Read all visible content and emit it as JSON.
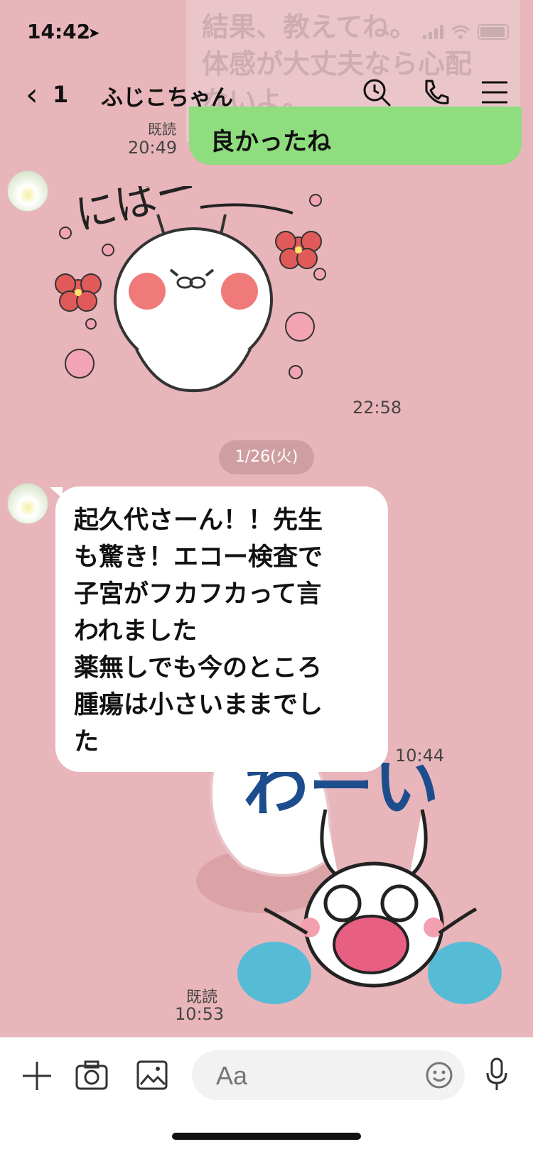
{
  "status_bar": {
    "time": "14:42"
  },
  "header": {
    "back_count": "1",
    "title": "ふじこちゃん"
  },
  "previous_message": {
    "faded_text": "結果、教えてね。\n体感が大丈夫なら心配\nないよ。",
    "visible_text": "良かったね",
    "read_label": "既読",
    "time": "20:49"
  },
  "sticker_1": {
    "text": "にぱー",
    "time": "22:58"
  },
  "date_separator": "1/26(火)",
  "incoming_message": {
    "text": "起久代さーん！！先生\nも驚き！エコー検査で\n子宮がフカフカって言\nわれました\n薬無しでも今のところ\n腫瘍は小さいままでし\nた",
    "time": "10:44"
  },
  "sticker_2": {
    "text": "わーい",
    "read_label": "既読",
    "time": "10:53"
  },
  "input": {
    "placeholder": "Aa"
  },
  "colors": {
    "background": "#e8b5ba",
    "outgoing_bubble": "#8fdd7e",
    "sticker_blue": "#1d4d8c"
  }
}
